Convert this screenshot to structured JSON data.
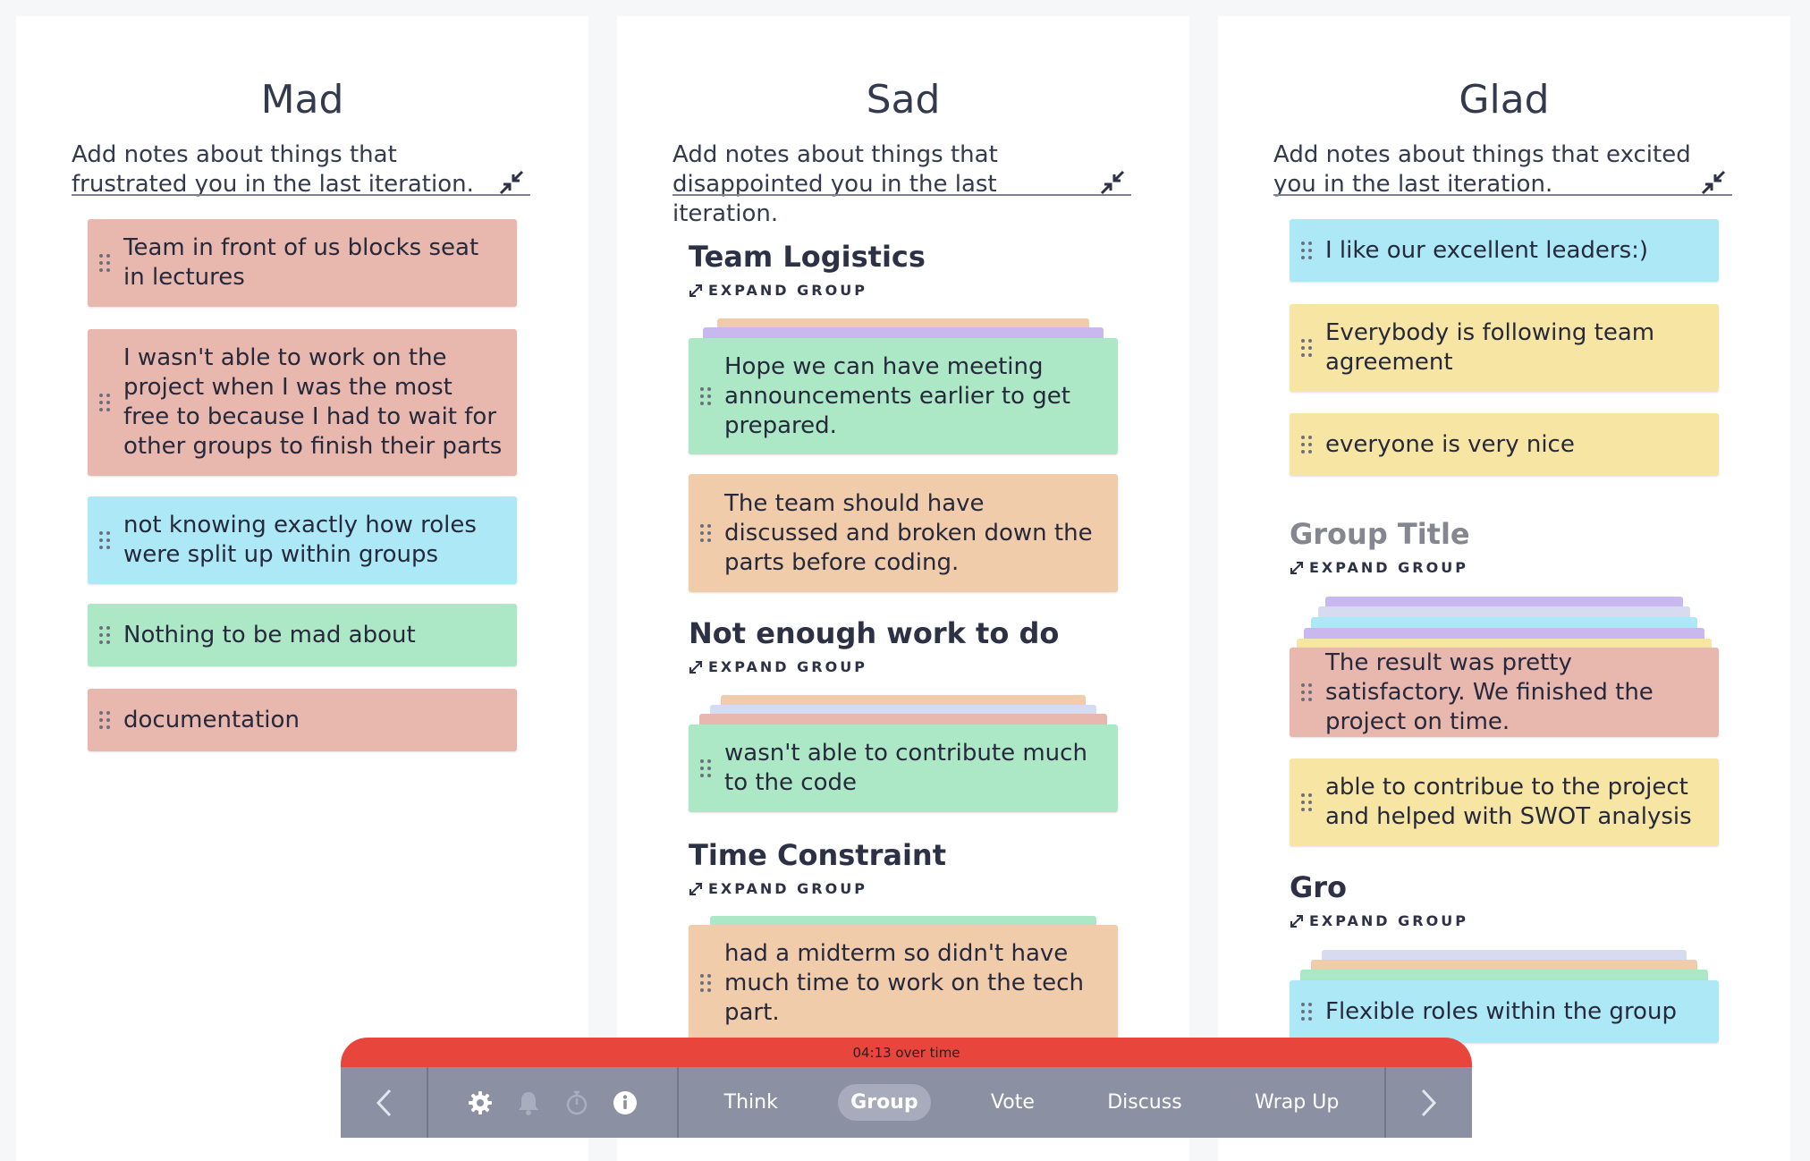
{
  "columns": [
    {
      "title": "Mad",
      "description": "Add notes about things that frustrated you in the last iteration.",
      "notes": [
        {
          "text": "Team in front of us blocks seat in lectures",
          "color": "red"
        },
        {
          "text": "I wasn't able to work on the project when I was the most free to because I had to wait for other groups to finish their parts",
          "color": "red"
        },
        {
          "text": "not knowing exactly how roles were split up within groups",
          "color": "blue"
        },
        {
          "text": "Nothing to be mad about",
          "color": "green"
        },
        {
          "text": "documentation",
          "color": "red"
        }
      ]
    },
    {
      "title": "Sad",
      "description": "Add notes about things that disappointed you in the last iteration.",
      "groups": [
        {
          "title": "Team Logistics",
          "expand_label": "EXPAND GROUP",
          "notes": [
            {
              "text": "Hope we can have meeting announcements earlier to get prepared.",
              "color": "green"
            },
            {
              "text": "The team should have discussed and broken down the parts before coding.",
              "color": "orange"
            }
          ]
        },
        {
          "title": "Not enough work to do",
          "expand_label": "EXPAND GROUP",
          "notes": [
            {
              "text": "wasn't able to contribute much to the code",
              "color": "green"
            }
          ]
        },
        {
          "title": "Time Constraint",
          "expand_label": "EXPAND GROUP",
          "notes": [
            {
              "text": "had a midterm so didn't have much time to work on the tech part.",
              "color": "orange"
            }
          ]
        }
      ]
    },
    {
      "title": "Glad",
      "description": "Add notes about things that excited you in the last iteration.",
      "notes": [
        {
          "text": "I like our excellent leaders:)",
          "color": "blue"
        },
        {
          "text": "Everybody is following team agreement",
          "color": "yellow"
        },
        {
          "text": "everyone is very nice",
          "color": "yellow"
        }
      ],
      "groups": [
        {
          "title": "Group Title",
          "expand_label": "EXPAND GROUP",
          "notes": [
            {
              "text": "The result was pretty satisfactory. We finished the project on time.",
              "color": "red"
            },
            {
              "text": "able to contribue to the project and helped with SWOT analysis",
              "color": "yellow"
            }
          ]
        },
        {
          "title": "Gro",
          "expand_label": "EXPAND GROUP",
          "notes": [
            {
              "text": "Flexible roles within the group",
              "color": "blue"
            }
          ]
        }
      ]
    }
  ],
  "timer": {
    "text": "04:13 over time"
  },
  "toolbar": {
    "icons": [
      "chevron-left-icon",
      "gear-icon",
      "bell-icon",
      "stopwatch-icon",
      "info-icon",
      "chevron-right-icon"
    ],
    "steps": [
      "Think",
      "Group",
      "Vote",
      "Discuss",
      "Wrap Up"
    ],
    "active_step": "Group"
  },
  "colors": {
    "red": "#e8b7ad",
    "blue": "#ade8f7",
    "green": "#ace8c6",
    "yellow": "#f7e5a3",
    "orange": "#f0ccab",
    "timer_bar": "#e8463c",
    "toolbar": "#8c90a3"
  }
}
